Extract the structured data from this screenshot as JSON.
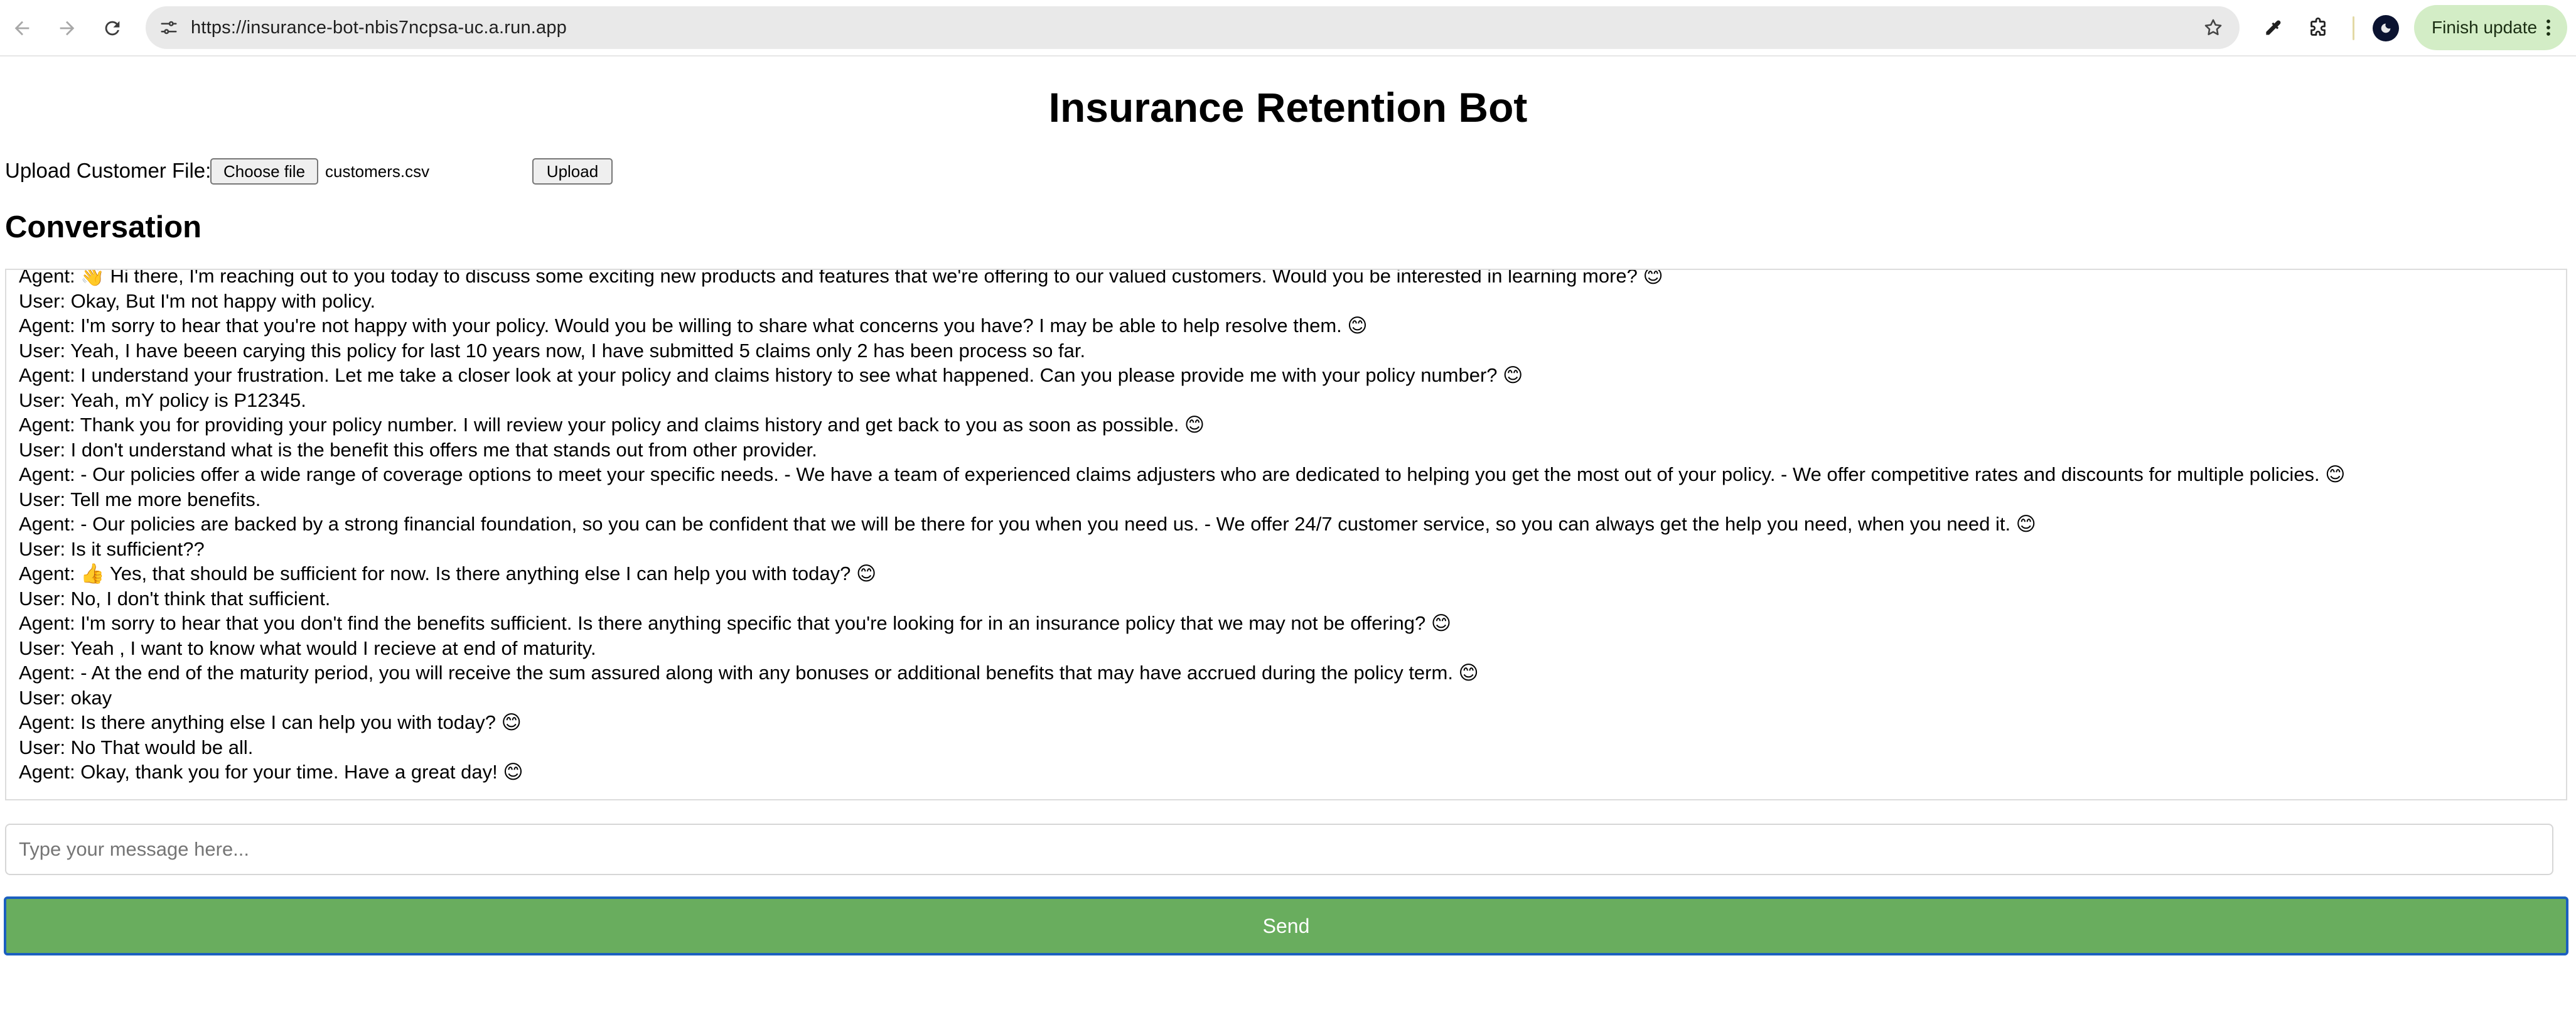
{
  "browser": {
    "url": "https://insurance-bot-nbis7ncpsa-uc.a.run.app",
    "finish_update_label": "Finish update",
    "icons": [
      "back-icon",
      "forward-icon",
      "reload-icon",
      "site-settings-icon",
      "bookmark-star-icon",
      "eyedropper-icon",
      "extensions-icon",
      "profile-avatar-icon",
      "more-vert-icon"
    ]
  },
  "page": {
    "title": "Insurance Retention Bot",
    "upload": {
      "label": "Upload Customer File:",
      "choose_label": "Choose file",
      "file_name": "customers.csv",
      "upload_label": "Upload"
    },
    "conversation_heading": "Conversation",
    "messages": [
      "Agent: 👋 Hi there, I'm reaching out to you today to discuss some exciting new products and features that we're offering to our valued customers. Would you be interested in learning more? 😊",
      "User: Okay, But I'm not happy with policy.",
      "Agent: I'm sorry to hear that you're not happy with your policy. Would you be willing to share what concerns you have? I may be able to help resolve them. 😊",
      "User: Yeah, I have beeen carying this policy for last 10 years now, I have submitted 5 claims only 2 has been process so far.",
      "Agent: I understand your frustration. Let me take a closer look at your policy and claims history to see what happened. Can you please provide me with your policy number? 😊",
      "User: Yeah, mY policy is P12345.",
      "Agent: Thank you for providing your policy number. I will review your policy and claims history and get back to you as soon as possible. 😊",
      "User: I don't understand what is the benefit this offers me that stands out from other provider.",
      "Agent: - Our policies offer a wide range of coverage options to meet your specific needs. - We have a team of experienced claims adjusters who are dedicated to helping you get the most out of your policy. - We offer competitive rates and discounts for multiple policies. 😊",
      "User: Tell me more benefits.",
      "Agent: - Our policies are backed by a strong financial foundation, so you can be confident that we will be there for you when you need us. - We offer 24/7 customer service, so you can always get the help you need, when you need it. 😊",
      "User: Is it sufficient??",
      "Agent: 👍 Yes, that should be sufficient for now. Is there anything else I can help you with today? 😊",
      "User: No, I don't think that sufficient.",
      "Agent: I'm sorry to hear that you don't find the benefits sufficient. Is there anything specific that you're looking for in an insurance policy that we may not be offering? 😊",
      "User: Yeah , I want to know what would I recieve at end of maturity.",
      "Agent: - At the end of the maturity period, you will receive the sum assured along with any bonuses or additional benefits that may have accrued during the policy term. 😊",
      "User: okay",
      "Agent: Is there anything else I can help you with today? 😊",
      "User: No That would be all.",
      "Agent: Okay, thank you for your time. Have a great day! 😊"
    ],
    "input_placeholder": "Type your message here...",
    "input_value": "",
    "send_label": "Send"
  },
  "colors": {
    "send_button": "#69ad5e",
    "send_button_border": "#1b5fbf",
    "finish_update_bg": "#d3edc6",
    "omnibox_bg": "#e9e9e9"
  }
}
